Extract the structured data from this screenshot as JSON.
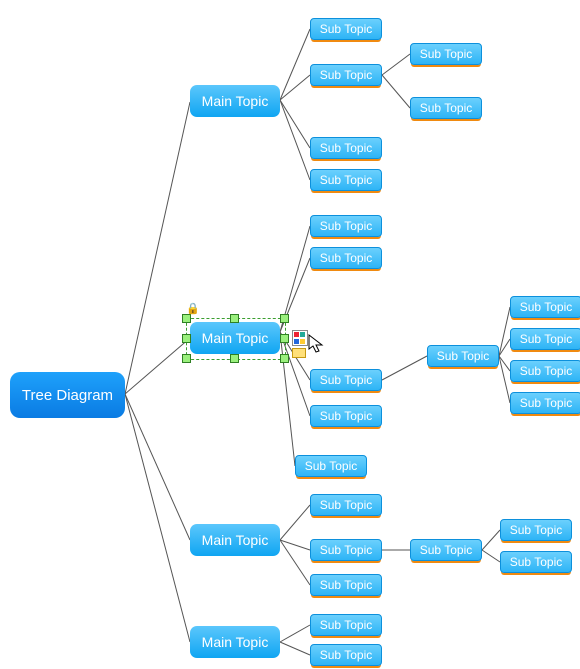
{
  "root": {
    "label": "Tree Diagram"
  },
  "mains": [
    {
      "label": "Main Topic"
    },
    {
      "label": "Main Topic"
    },
    {
      "label": "Main Topic"
    },
    {
      "label": "Main Topic"
    }
  ],
  "subs_cluster1": [
    {
      "label": "Sub Topic"
    },
    {
      "label": "Sub Topic"
    },
    {
      "label": "Sub Topic"
    },
    {
      "label": "Sub Topic"
    }
  ],
  "subs_cluster1_leaf": [
    {
      "label": "Sub Topic"
    },
    {
      "label": "Sub Topic"
    }
  ],
  "subs_cluster2_top": [
    {
      "label": "Sub Topic"
    },
    {
      "label": "Sub Topic"
    }
  ],
  "subs_cluster2_mid": {
    "label": "Sub Topic"
  },
  "subs_cluster2_mid_child": {
    "label": "Sub Topic"
  },
  "subs_cluster2_mid_leaf": [
    {
      "label": "Sub Topic"
    },
    {
      "label": "Sub Topic"
    },
    {
      "label": "Sub Topic"
    },
    {
      "label": "Sub Topic"
    }
  ],
  "subs_cluster2_extra": [
    {
      "label": "Sub Topic"
    },
    {
      "label": "Sub Topic"
    }
  ],
  "subs_cluster3": [
    {
      "label": "Sub Topic"
    },
    {
      "label": "Sub Topic"
    },
    {
      "label": "Sub Topic"
    }
  ],
  "subs_cluster3_mid": {
    "label": "Sub Topic"
  },
  "subs_cluster3_leaf": [
    {
      "label": "Sub Topic"
    },
    {
      "label": "Sub Topic"
    }
  ],
  "subs_cluster4": [
    {
      "label": "Sub Topic"
    },
    {
      "label": "Sub Topic"
    }
  ],
  "colors": {
    "line": "#4a4a4a",
    "accent_blue": "#0fa5f2",
    "accent_orange": "#f08a10",
    "selection_green": "#3a9e2f"
  },
  "selected_node_index": 1
}
